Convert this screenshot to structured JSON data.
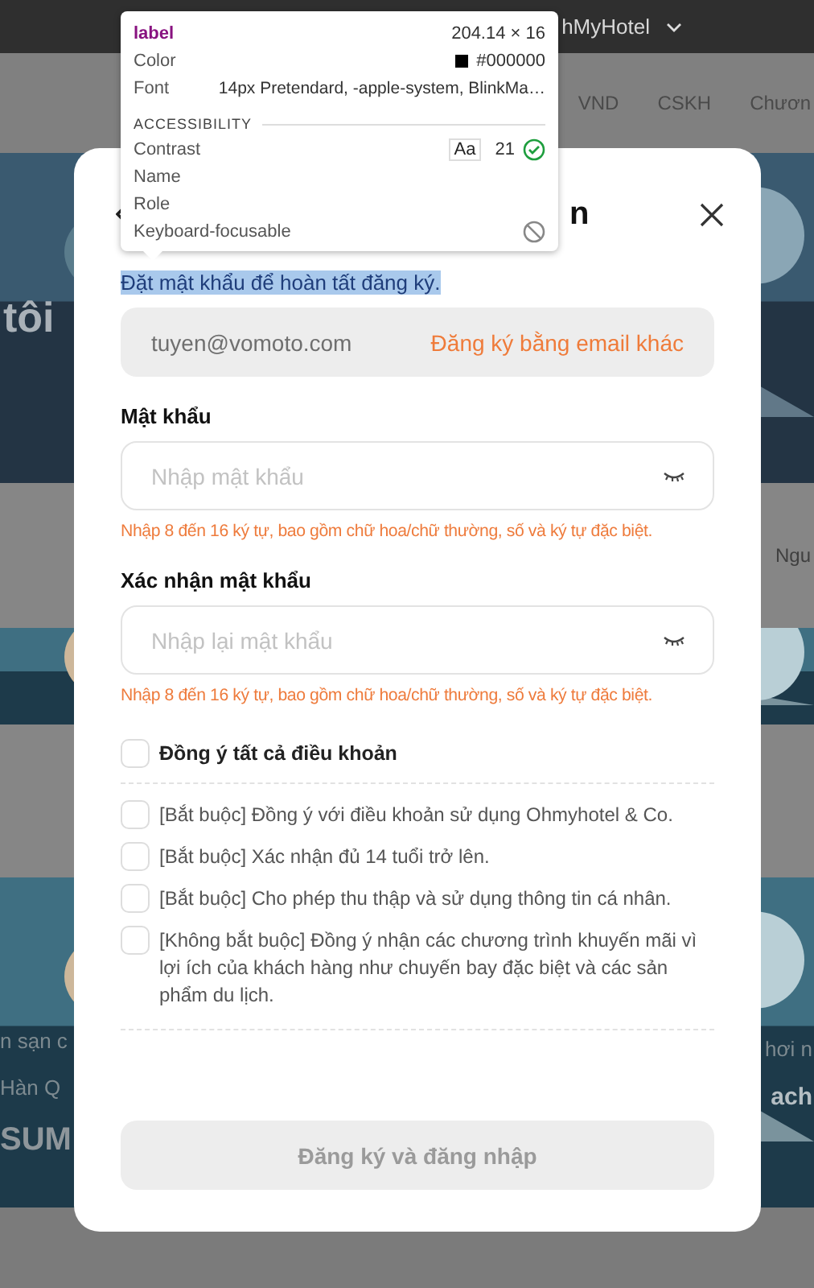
{
  "background_page": {
    "header": {
      "brand": "hMyHotel"
    },
    "nav": [
      "VND",
      "CSKH",
      "Chươn"
    ],
    "hero": {
      "text": "tôi"
    },
    "band": {
      "text": "Ngu"
    },
    "promo": {
      "left": [
        "n sạn c",
        "Hàn Q",
        "SUM"
      ],
      "right": [
        "hơi n",
        "ach"
      ]
    }
  },
  "modal": {
    "title": "n",
    "subtitle": "Đặt mật khẩu để hoàn tất đăng ký.",
    "subtitle_selected": true,
    "email": {
      "value": "tuyen@vomoto.com",
      "link": "Đăng ký bằng email khác"
    },
    "fields": [
      {
        "label": "Mật khẩu",
        "placeholder": "Nhập mật khẩu",
        "hint": "Nhập 8 đến 16 ký tự, bao gồm chữ hoa/chữ thường, số và ký tự đặc biệt."
      },
      {
        "label": "Xác nhận mật khẩu",
        "placeholder": "Nhập lại mật khẩu",
        "hint": "Nhập 8 đến 16 ký tự, bao gồm chữ hoa/chữ thường, số và ký tự đặc biệt."
      }
    ],
    "agree_all": {
      "label": "Đồng ý tất cả điều khoản",
      "checked": false
    },
    "terms": [
      {
        "label": "[Bắt buộc] Đồng ý với điều khoản sử dụng Ohmyhotel & Co.",
        "checked": false
      },
      {
        "label": "[Bắt buộc] Xác nhận đủ 14 tuổi trở lên.",
        "checked": false
      },
      {
        "label": "[Bắt buộc] Cho phép thu thập và sử dụng thông tin cá nhân.",
        "checked": false
      },
      {
        "label": "[Không bắt buộc] Đồng ý nhận các chương trình khuyến mãi vì lợi ích của khách hàng như chuyến bay đặc biệt và các sản phẩm du lịch.",
        "checked": false
      }
    ],
    "submit": {
      "label": "Đăng ký và đăng nhập",
      "disabled": true
    }
  },
  "devtools_tooltip": {
    "tag": "label",
    "size": "204.14 × 16",
    "props": [
      {
        "name": "Color",
        "value": "#000000",
        "kind": "color"
      },
      {
        "name": "Font",
        "value": "14px Pretendard, -apple-system, BlinkMa…",
        "kind": "text"
      }
    ],
    "section": "ACCESSIBILITY",
    "accessibility": [
      {
        "name": "Contrast",
        "kind": "contrast",
        "sample": "Aa",
        "value": "21",
        "pass": true
      },
      {
        "name": "Name",
        "kind": "empty"
      },
      {
        "name": "Role",
        "kind": "empty"
      },
      {
        "name": "Keyboard-focusable",
        "kind": "flag",
        "on": false
      }
    ]
  }
}
